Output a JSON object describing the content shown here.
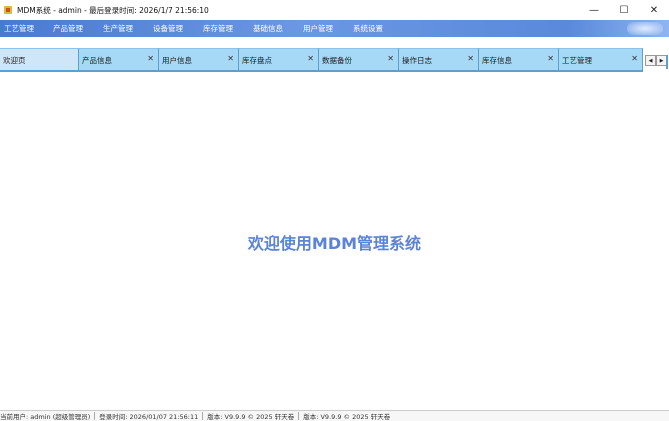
{
  "window": {
    "title": "MDM系统 - admin - 最后登录时间: 2026/1/7 21:56:10",
    "minimize": "—",
    "maximize": "☐",
    "close": "✕"
  },
  "menu": {
    "items": [
      "工艺管理",
      "产品管理",
      "生产管理",
      "设备管理",
      "库存管理",
      "基础信息",
      "用户管理",
      "系统设置"
    ]
  },
  "tabs": {
    "home": "欢迎页",
    "items": [
      "产品信息",
      "用户信息",
      "库存盘点",
      "数据备份",
      "操作日志",
      "库存信息",
      "工艺管理"
    ],
    "close_glyph": "✕",
    "scroll_left": "◀",
    "scroll_right": "▶"
  },
  "main": {
    "welcome_text": "欢迎使用MDM管理系统"
  },
  "status": {
    "user": "当前用户: admin (超级管理员)",
    "login_time": "登录时间: 2026/01/07 21:56:11",
    "version1": "版本: V9.9.9 © 2025 轩天卷",
    "version2": "版本: V9.9.9 © 2025 轩天卷"
  },
  "colors": {
    "menu_bar": "#5a89dc",
    "tab_bg": "#a6d9f5",
    "welcome": "#5b83d8"
  }
}
